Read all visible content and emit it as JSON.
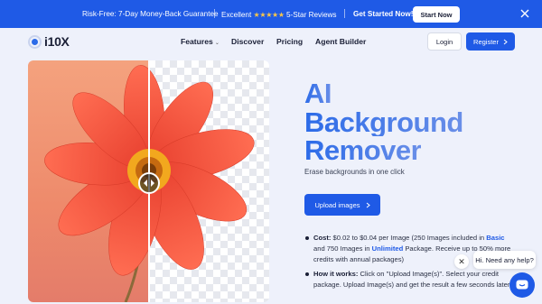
{
  "banner": {
    "guarantee": "Risk-Free: 7-Day Money-Back Guarantee",
    "excellent": "Excellent",
    "stars": "★★★★★",
    "reviews": "5-Star Reviews",
    "cta": "Get Started Now!",
    "button": "Start Now"
  },
  "nav": {
    "logo": "i10X",
    "links": [
      "Features",
      "Discover",
      "Pricing",
      "Agent Builder"
    ],
    "login": "Login",
    "register": "Register"
  },
  "hero": {
    "title_lines": [
      "AI",
      "Background",
      "Remover"
    ],
    "subtitle": "Erase backgrounds in one click",
    "upload": "Upload images",
    "cost": {
      "label": "Cost:",
      "text1": "$0.02 to $0.04 per Image (250 Images included in",
      "plan1": "Basic",
      "text2": "and 750 Images in",
      "plan2": "Unlimited",
      "text3": "Package. Receive up to 50% more credits with annual packages)"
    },
    "how": {
      "label": "How it works:",
      "text": "Click on \"Upload Image(s)\". Select your credit package. Upload Image(s) and get the result a few seconds later"
    }
  },
  "chat": {
    "greeting": "Hi. Need any help?"
  },
  "colors": {
    "brand": "#1f5ae6",
    "title_gradient_start": "#2c6be8",
    "title_gradient_end": "#6a8fe8",
    "star": "#f7c64a"
  },
  "icons": [
    "close-icon",
    "chevron-down-icon",
    "arrow-right-icon",
    "compare-arrows-icon",
    "chat-icon"
  ]
}
